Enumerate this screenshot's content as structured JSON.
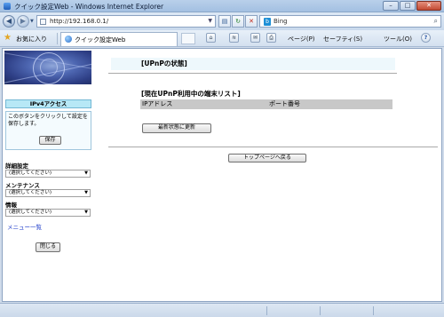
{
  "window": {
    "title": "クイック設定Web - Windows Internet Explorer",
    "controls": {
      "minimize": "–",
      "maximize": "□",
      "close": "✕"
    }
  },
  "address_bar": {
    "url": "http://192.168.0.1/",
    "search_placeholder": "Bing"
  },
  "command_bar": {
    "favorites_label": "お気に入り",
    "tab_title": "クイック設定Web",
    "page_menu": "ページ(P)",
    "safety_menu": "セーフティ(S)",
    "tools_menu": "ツール(O)",
    "help_icon": "?"
  },
  "sidebar": {
    "ipv4_label": "IPv4アクセス",
    "save_description": "このボタンをクリックして設定を保存します。",
    "save_button": "保存",
    "menus": [
      {
        "label": "詳細設定",
        "value": "(選択してください)"
      },
      {
        "label": "メンテナンス",
        "value": "(選択してください)"
      },
      {
        "label": "情報",
        "value": "(選択してください)"
      }
    ],
    "menu_list_link": "メニュー一覧",
    "close_button": "閉じる"
  },
  "main": {
    "status_title": "[UPnPの状態]",
    "list_title": "[現在UPnP利用中の端末リスト]",
    "table_headers": [
      "IPアドレス",
      "ポート番号"
    ],
    "refresh_button": "最新状態に更新",
    "top_page_button": "トップページへ戻る"
  },
  "colors": {
    "ipv4_bg": "#b7e8f6",
    "status_title_bg": "#eef8fc",
    "table_header_bg": "#c8c8c8",
    "link": "#1a39c9"
  }
}
